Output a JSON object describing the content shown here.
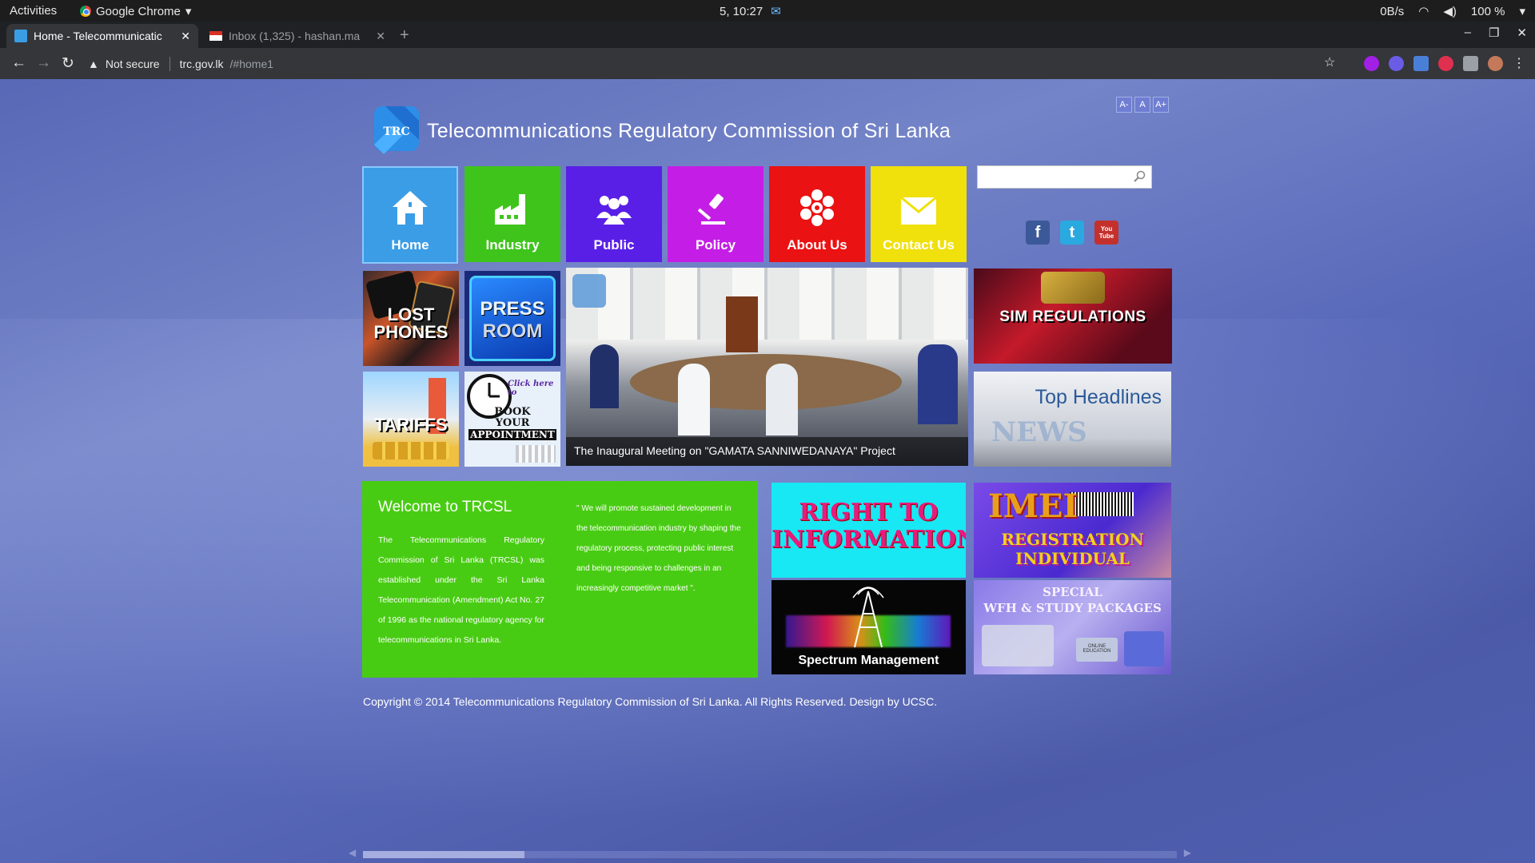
{
  "os": {
    "activities": "Activities",
    "app_name": "Google Chrome",
    "clock": "5, 10:27",
    "net_speed": "0B/s",
    "battery": "100 %"
  },
  "browser": {
    "tabs": [
      {
        "title": "Home - Telecommunicatic",
        "active": true
      },
      {
        "title": "Inbox (1,325) - hashan.ma",
        "active": false
      }
    ],
    "security": "Not secure",
    "url_host": "trc.gov.lk",
    "url_path": "/#home1"
  },
  "page": {
    "font_controls": [
      "A-",
      "A",
      "A+"
    ],
    "site_title": "Telecommunications Regulatory Commission of Sri Lanka",
    "logo_text": "TRC",
    "menu": [
      {
        "label": "Home",
        "color": "#3b9de6",
        "icon": "home-icon"
      },
      {
        "label": "Industry",
        "color": "#3fc41c",
        "icon": "factory-icon"
      },
      {
        "label": "Public",
        "color": "#5a1fe6",
        "icon": "people-icon"
      },
      {
        "label": "Policy",
        "color": "#c41ee6",
        "icon": "gavel-icon"
      },
      {
        "label": "About Us",
        "color": "#ea1213",
        "icon": "snowflake-icon"
      },
      {
        "label": "Contact Us",
        "color": "#f0e00c",
        "icon": "envelope-icon"
      }
    ],
    "social": [
      "f",
      "t",
      "You Tube"
    ],
    "tiles": {
      "lost_phones": "LOST PHONES",
      "press_room": [
        "PRESS",
        "ROOM"
      ],
      "tariffs": "TARIFFS",
      "appointment_click": "Click here to",
      "appointment": [
        "BOOK",
        "YOUR",
        "APPOINTMENT"
      ],
      "sim": "SIM REGULATIONS",
      "headlines": "Top Headlines",
      "news": "NEWS",
      "rti": [
        "RIGHT TO",
        "INFORMATION"
      ],
      "imei": "IMEI",
      "imei_sub": [
        "REGISTRATION",
        "INDIVIDUAL"
      ],
      "spectrum": "Spectrum Management",
      "wfh": [
        "SPECIAL",
        "WFH & STUDY PACKAGES"
      ],
      "wfh_small": "ONLINE EDUCATION"
    },
    "slider_caption": "The Inaugural Meeting on \"GAMATA SANNIWEDANAYA\" Project",
    "welcome": {
      "heading": "Welcome to TRCSL",
      "body": "The Telecommunications Regulatory Commission of Sri Lanka (TRCSL) was established under the Sri Lanka Telecommunication (Amendment) Act No. 27 of 1996 as the national regulatory agency for telecommunications in Sri Lanka.",
      "quote": "\" We will promote sustained development in the telecommunication industry by shaping the regulatory process, protecting public interest and being responsive to challenges in an increasingly competitive market \"."
    },
    "footer": "Copyright © 2014 Telecommunications Regulatory Commission of Sri Lanka. All Rights Reserved. Design by UCSC."
  }
}
